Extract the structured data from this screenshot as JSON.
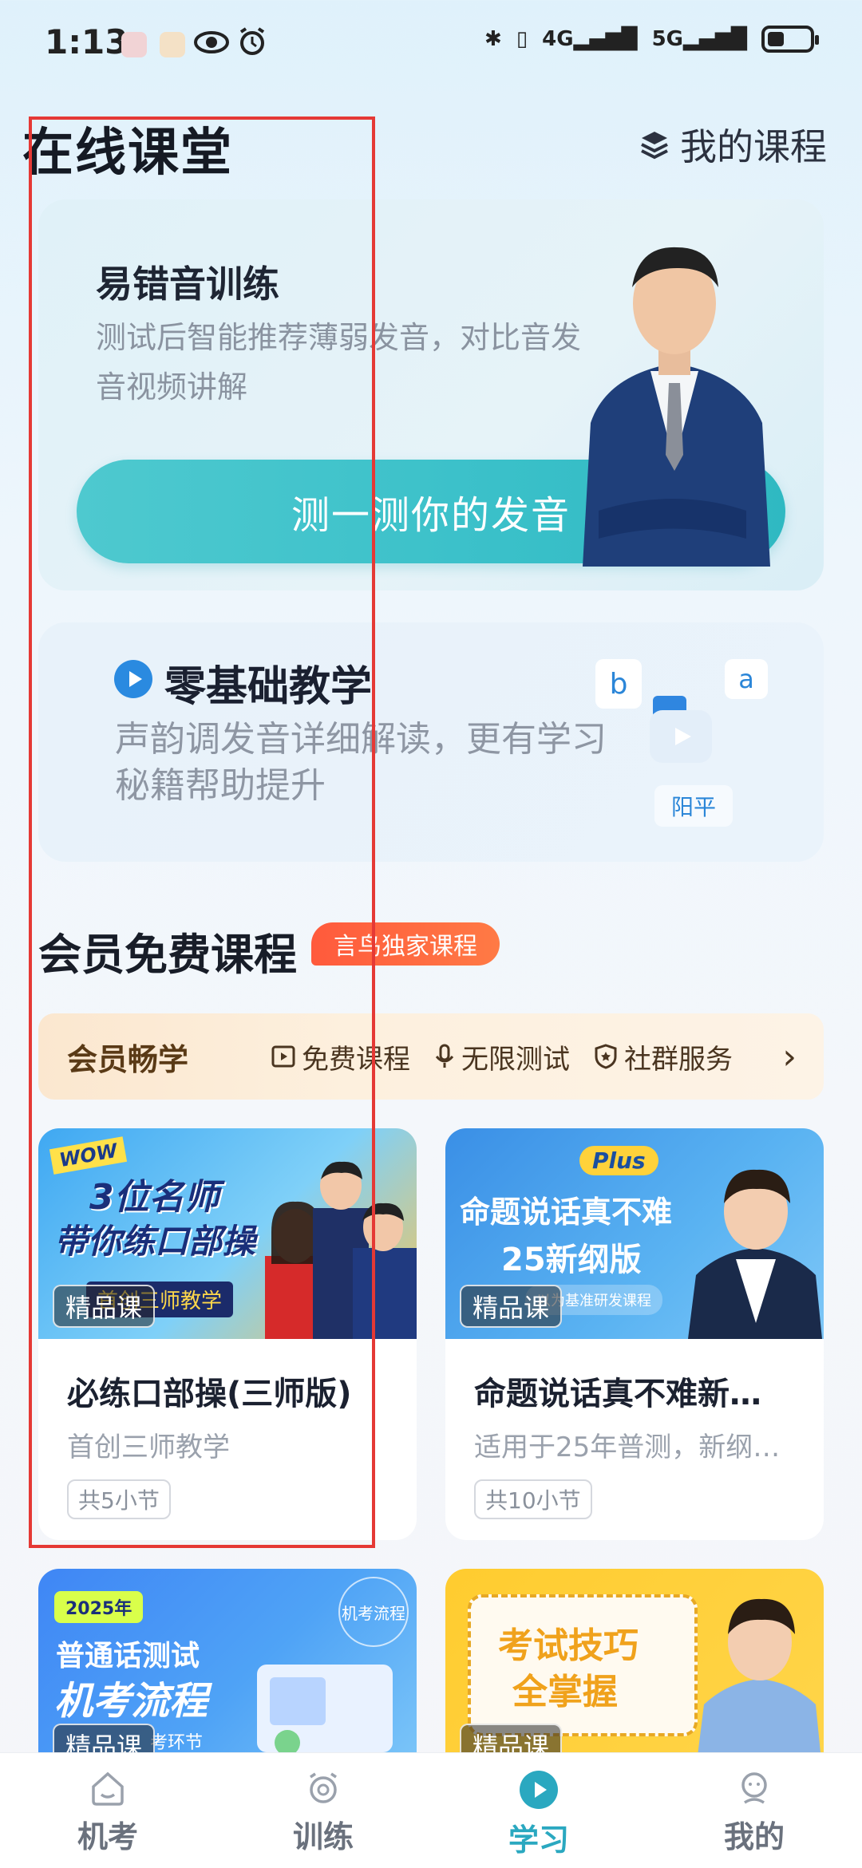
{
  "status_bar": {
    "time": "1:13",
    "net1": "4G",
    "net2": "5G"
  },
  "header": {
    "title": "在线课堂",
    "my_courses": "我的课程"
  },
  "card_pronunciation": {
    "title": "易错音训练",
    "desc": "测试后智能推荐薄弱发音，对比音发音视频讲解",
    "cta": "测一测你的发音"
  },
  "card_basics": {
    "title": "零基础教学",
    "desc": "声韵调发音详细解读，更有学习秘籍帮助提升",
    "tile_b": "b",
    "tile_a": "a",
    "tone_chip": "阳平"
  },
  "member_section": {
    "title": "会员免费课程",
    "badge": "言鸟独家课程",
    "bar_label": "会员畅学",
    "features": [
      "免费课程",
      "无限测试",
      "社群服务"
    ]
  },
  "courses": [
    {
      "tag": "精品课",
      "thumb_badge": "WOW",
      "thumb_line1": "3位名师",
      "thumb_line2": "带你练口部操",
      "thumb_line3": "首创三师教学",
      "title": "必练口部操(三师版)",
      "subtitle": "首创三师教学",
      "count": "共5小节"
    },
    {
      "tag": "精品课",
      "thumb_badge": "Plus",
      "thumb_line1": "命题说话真不难",
      "thumb_line2": "25新纲版",
      "thumb_line3": "以为基准研发课程",
      "title": "命题说话真不难新…",
      "subtitle": "适用于25年普测，新纲…",
      "count": "共10小节"
    },
    {
      "tag": "精品课",
      "thumb_badge": "2025年",
      "thumb_line1": "普通话测试",
      "thumb_line2": "机考流程",
      "thumb_line3": "考环节",
      "corner": "机考流程"
    },
    {
      "tag": "精品课",
      "thumb_line1": "考试技巧",
      "thumb_line2": "全掌握"
    }
  ],
  "bottom_nav": [
    {
      "label": "机考",
      "icon": "home-icon"
    },
    {
      "label": "训练",
      "icon": "alarm-icon"
    },
    {
      "label": "学习",
      "icon": "play-circle-icon",
      "active": true
    },
    {
      "label": "我的",
      "icon": "profile-icon"
    }
  ],
  "colors": {
    "accent": "#2aa8c0",
    "cta": "#3ac0c9",
    "badge": "#ff5a3c",
    "highlight": "#e53935"
  }
}
